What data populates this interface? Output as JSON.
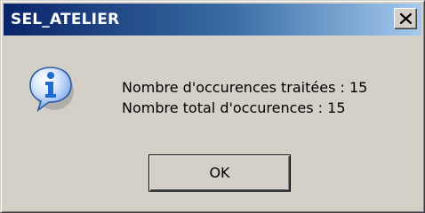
{
  "window": {
    "title": "SEL_ATELIER",
    "close_icon": "close-x-icon"
  },
  "message": {
    "icon": "info-icon",
    "line1": "Nombre d'occurences traitées : 15",
    "line2": "Nombre total d'occurences : 15"
  },
  "buttons": {
    "ok_label": "OK"
  },
  "colors": {
    "titlebar_start": "#0a246a",
    "titlebar_end": "#a6caf0",
    "dialog_face": "#d4d0c8",
    "icon_blue": "#1e6ccf"
  }
}
